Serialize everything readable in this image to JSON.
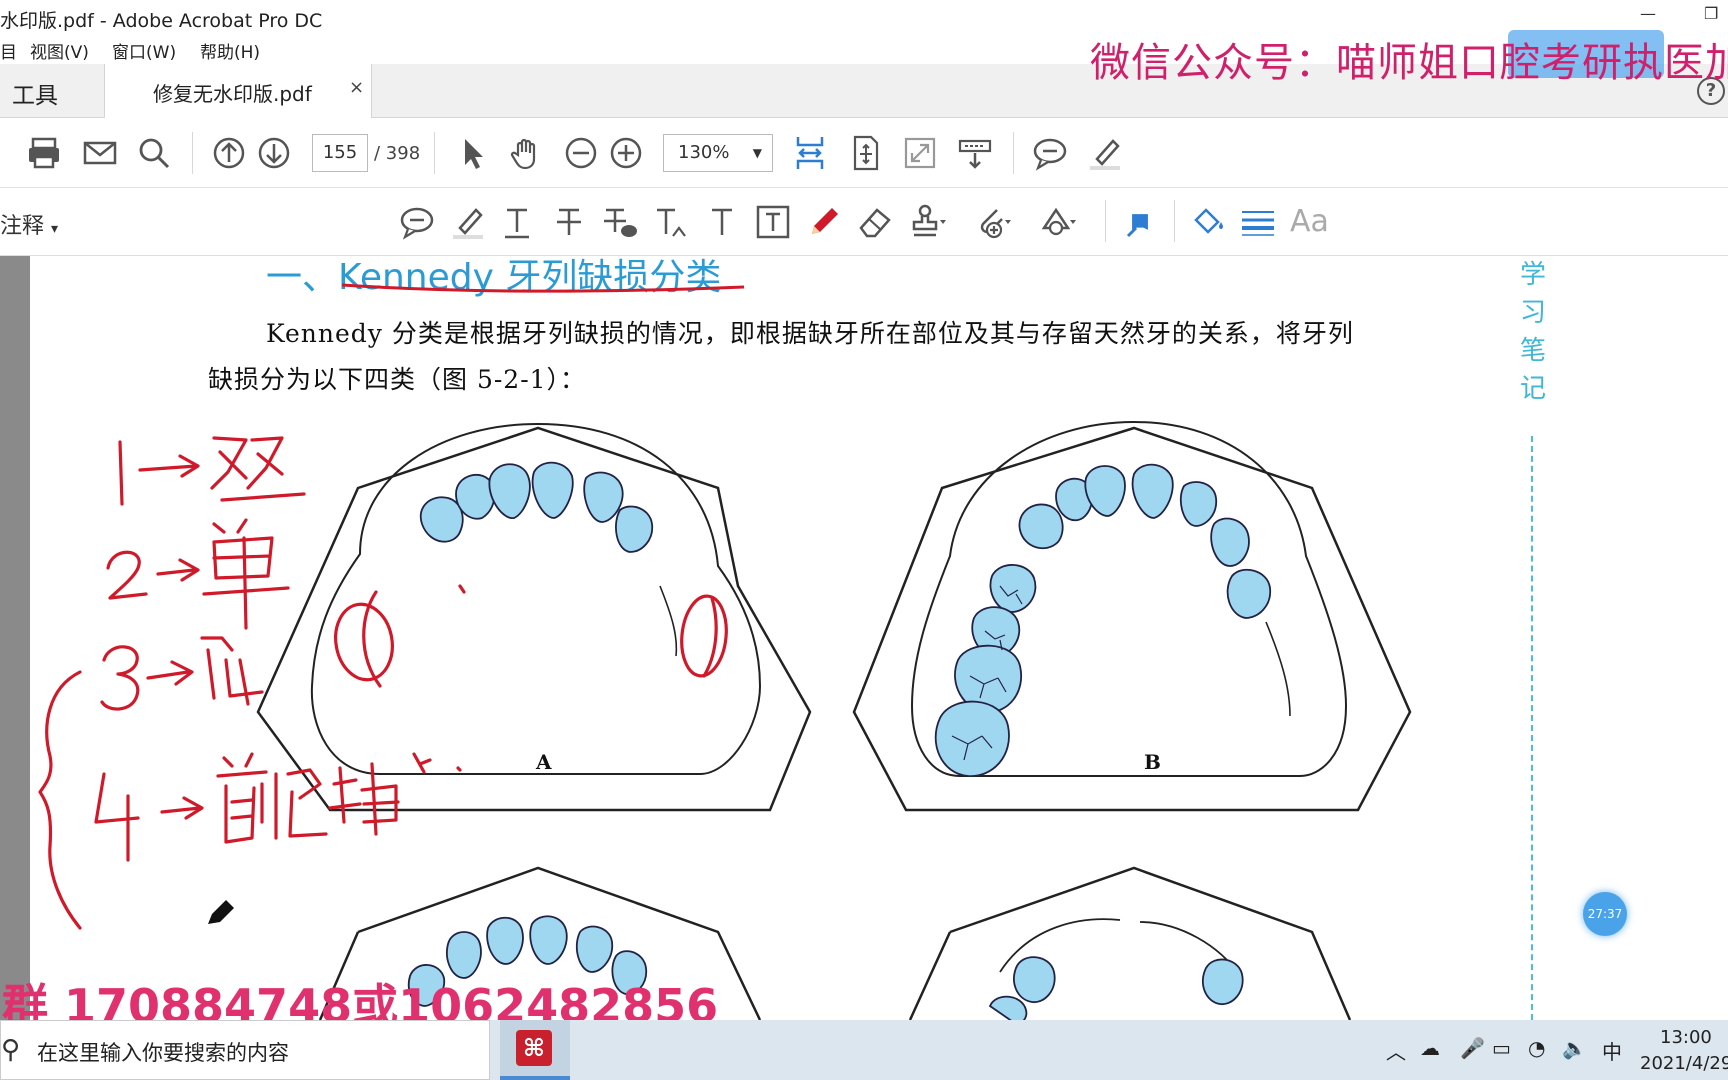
{
  "window": {
    "title": "水印版.pdf - Adobe Acrobat Pro DC",
    "minimize": "—",
    "restore": "❐"
  },
  "menu": {
    "items": [
      "目",
      "视图(V)",
      "窗口(W)",
      "帮助(H)"
    ]
  },
  "tabs": {
    "tools": "工具",
    "document": "修复无水印版.pdf",
    "close": "×",
    "help": "?"
  },
  "watermark": {
    "top": "微信公众号：喵师姐口腔考研执医加",
    "bottom": "群  170884748或1062482856"
  },
  "toolbar": {
    "current_page": "155",
    "total_pages": "/ 398",
    "zoom": "130%",
    "icons": [
      "print-icon",
      "email-icon",
      "search-icon",
      "page-up-icon",
      "page-down-icon",
      "select-cursor-icon",
      "hand-icon",
      "zoom-out-icon",
      "zoom-in-icon",
      "fit-width-icon",
      "fit-page-icon",
      "fullscreen-icon",
      "scroll-mode-icon",
      "comment-icon",
      "highlight-icon"
    ]
  },
  "comment_toolbar": {
    "label": "注释",
    "label_arrow": "▾",
    "icons": [
      "sticky-note-icon",
      "highlight-text-icon",
      "underline-text-icon",
      "strikethrough-icon",
      "replace-text-icon",
      "insert-text-icon",
      "add-text-icon",
      "text-box-icon",
      "pencil-icon",
      "eraser-icon",
      "stamp-icon",
      "attach-file-icon",
      "shapes-icon",
      "pin-icon",
      "fill-color-icon",
      "line-weight-icon",
      "font-size-icon"
    ],
    "font_label": "Aa"
  },
  "document": {
    "heading": "一、Kennedy 牙列缺损分类",
    "paragraph_line1": "Kennedy 分类是根据牙列缺损的情况，即根据缺牙所在部位及其与存留天然牙的关系，将牙列",
    "paragraph_line2": "缺损分为以下四类（图 5-2-1）：",
    "side_note": [
      "学",
      "习",
      "笔",
      "记"
    ],
    "figure_labels": [
      "A",
      "B"
    ],
    "handwriting": [
      "1→双",
      "2→单",
      "3→前",
      "4→前区缺"
    ]
  },
  "overlay": {
    "timer": "27:37"
  },
  "taskbar": {
    "search_placeholder": "在这里输入你要搜索的内容",
    "search_icon": "search-icon",
    "ime": "中",
    "time": "13:00",
    "date": "2021/4/29"
  },
  "colors": {
    "accent": "#2b9bd6",
    "tooth_fill": "#9fd6f0",
    "ink": "#d01a2a",
    "watermark": "#d0206c"
  }
}
